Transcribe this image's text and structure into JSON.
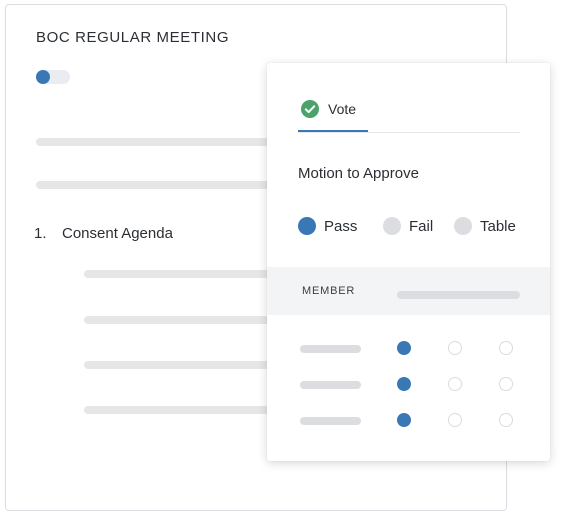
{
  "document": {
    "title": "BOC REGULAR MEETING",
    "toggle_on": true,
    "agenda": [
      {
        "number": "1.",
        "label": "Consent Agenda"
      }
    ]
  },
  "vote_panel": {
    "tab": {
      "label": "Vote",
      "icon": "check-circle-icon",
      "icon_color": "#4aa36b"
    },
    "motion_title": "Motion to Approve",
    "options": [
      {
        "label": "Pass",
        "selected": true
      },
      {
        "label": "Fail",
        "selected": false
      },
      {
        "label": "Table",
        "selected": false
      }
    ],
    "member_header": "MEMBER",
    "rows": [
      {
        "pass": true,
        "fail": false,
        "table": false
      },
      {
        "pass": true,
        "fail": false,
        "table": false
      },
      {
        "pass": true,
        "fail": false,
        "table": false
      }
    ]
  },
  "colors": {
    "accent": "#3a78b5",
    "success": "#4aa36b",
    "skeleton": "#e6e6e6"
  }
}
